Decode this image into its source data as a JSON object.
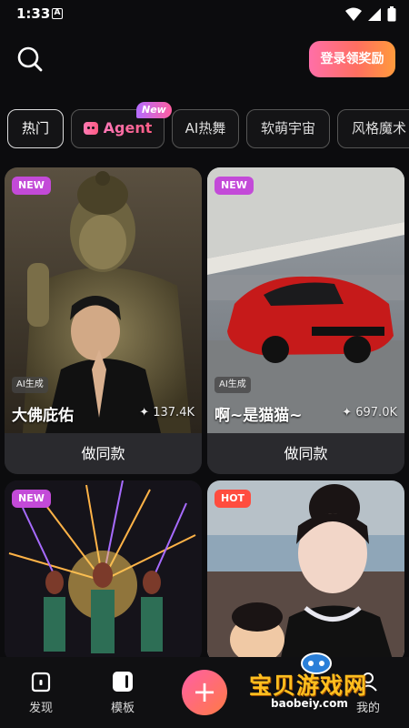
{
  "status_bar": {
    "time": "1:33",
    "notification_icon": "A"
  },
  "header": {
    "login_label": "登录领奖励"
  },
  "tabs": [
    {
      "label": "热门"
    },
    {
      "label": "Agent",
      "badge": "New"
    },
    {
      "label": "AI热舞"
    },
    {
      "label": "软萌宇宙"
    },
    {
      "label": "风格魔术"
    }
  ],
  "cards": [
    {
      "badge": "NEW",
      "tag": "AI生成",
      "title": "大佛庇佑",
      "stat": "✦ 137.4K",
      "action": "做同款"
    },
    {
      "badge": "NEW",
      "tag": "AI生成",
      "title": "啊~是猫猫~",
      "stat": "✦ 697.0K",
      "action": "做同款"
    },
    {
      "badge": "NEW"
    },
    {
      "badge": "HOT"
    }
  ],
  "bottom_nav": [
    {
      "label": "发现",
      "icon": "discover-icon"
    },
    {
      "label": "模板",
      "icon": "template-icon"
    },
    {
      "label": "+",
      "icon": "plus-icon"
    },
    {
      "label": "我的",
      "icon": "profile-icon"
    }
  ],
  "watermark": {
    "title": "宝贝游戏网",
    "url": "baobeiy.com"
  },
  "colors": {
    "accent_pink": "#ff5fa5",
    "accent_orange": "#ff7a45",
    "background": "#0c0c0e"
  }
}
